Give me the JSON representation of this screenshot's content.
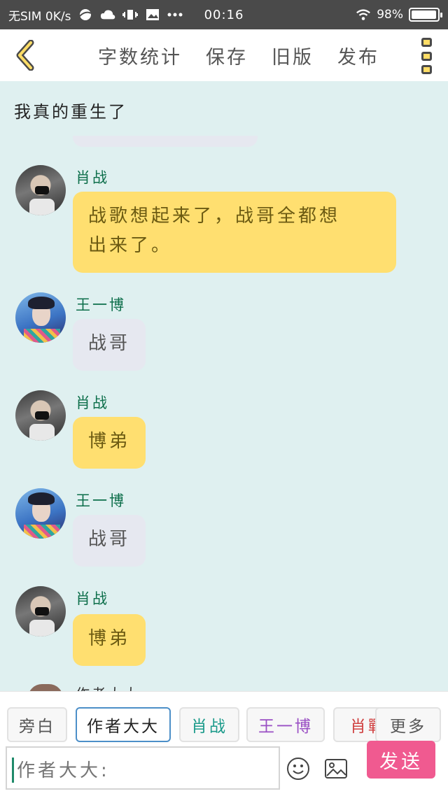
{
  "status_bar": {
    "carrier": "无SIM 0K/s",
    "time": "00:16",
    "battery": "98%",
    "battery_level": 0.98
  },
  "toolbar": {
    "word_count": "字数统计",
    "save": "保存",
    "old_version": "旧版",
    "publish": "发布"
  },
  "chat": {
    "title": "我真的重生了",
    "messages": [
      {
        "speaker": "肖战",
        "text_line1": "战歌想起来了，战哥全都想",
        "text_line2": "出来了。"
      },
      {
        "speaker": "王一博",
        "text": "战哥"
      },
      {
        "speaker": "肖战",
        "text": "博弟"
      },
      {
        "speaker": "王一博",
        "text": "战哥"
      },
      {
        "speaker": "肖战",
        "text": "博弟"
      }
    ],
    "partial_speaker": "作者大大"
  },
  "roles": [
    {
      "label": "旁白",
      "color": "#555555"
    },
    {
      "label": "作者大大",
      "color": "#222222"
    },
    {
      "label": "肖战",
      "color": "#1a9a8a"
    },
    {
      "label": "王一博",
      "color": "#9a4fc4"
    },
    {
      "label": "肖戰",
      "color": "#d04040"
    },
    {
      "label": "更多",
      "color": "#555555"
    }
  ],
  "input": {
    "placeholder": "作者大大:"
  },
  "send_label": "发送",
  "colors": {
    "background": "#dff0f0",
    "bubble_author": "#ffdf70",
    "bubble_other": "#e6e8f0",
    "send": "#f05a90",
    "speaker_name": "#0c6e4a"
  }
}
